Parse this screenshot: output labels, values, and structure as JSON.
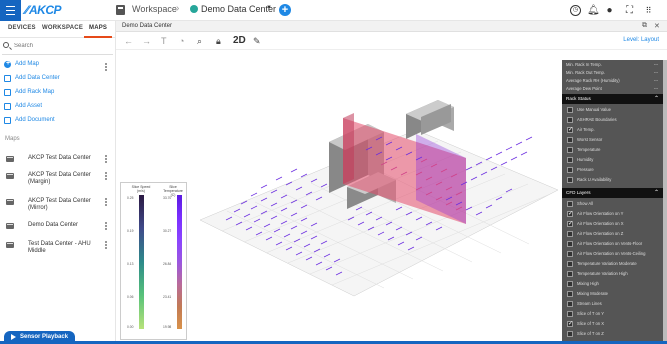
{
  "header": {
    "logo": "AKCP",
    "workspace_title": "Workspace",
    "datacenter_title": "Demo Data Center",
    "icons": [
      "menu-icon",
      "workspace-icon",
      "chevron-right-icon",
      "datacenter-dot-icon",
      "dropdown-caret-icon",
      "add-icon",
      "clock-icon",
      "notifications-icon",
      "user-icon",
      "fullscreen-icon",
      "apps-grid-icon"
    ]
  },
  "sidebar": {
    "tabs": [
      {
        "label": "DEVICES"
      },
      {
        "label": "WORKSPACE"
      },
      {
        "label": "MAPS"
      }
    ],
    "search": {
      "placeholder": "Search"
    },
    "actions": [
      {
        "label": "Add Map"
      },
      {
        "label": "Add Data Center"
      },
      {
        "label": "Add Rack Map"
      },
      {
        "label": "Add Asset"
      },
      {
        "label": "Add Document"
      }
    ],
    "maps_heading": "Maps",
    "maps": [
      {
        "name": "AKCP Test Data Center"
      },
      {
        "name": "AKCP Test Data Center (Margin)"
      },
      {
        "name": "AKCP Test Data Center (Mirror)"
      },
      {
        "name": "Demo Data Center"
      },
      {
        "name": "Test Data Center - AHU Middle"
      }
    ],
    "playback_label": "Sensor Playback"
  },
  "panel": {
    "title": "Demo Data Center",
    "toolbar": {
      "view_mode": "2D",
      "level_label": "Level: Layout"
    }
  },
  "legend": {
    "col1_title": "Slice Speed (m/s)",
    "col2_title": "Slice Temperature (C)",
    "col1_ticks": [
      "0.25",
      "0.19",
      "0.13",
      "0.06",
      "0.00"
    ],
    "col2_ticks": [
      "33.70",
      "30.27",
      "26.84",
      "23.41",
      "19.98"
    ]
  },
  "properties": {
    "metrics": [
      {
        "label": "Min. Rack In Temp.",
        "value": "---"
      },
      {
        "label": "Min. Rack Out Temp.",
        "value": "---"
      },
      {
        "label": "Average Rack RH (Humidity)",
        "value": "---"
      },
      {
        "label": "Average Dew Point",
        "value": "---"
      }
    ],
    "rack_status": {
      "title": "Rack Status",
      "items": [
        {
          "label": "Use Manual Value",
          "checked": false
        },
        {
          "label": "ASHRAE Boundaries",
          "checked": false
        },
        {
          "label": "Air Temp.",
          "checked": true
        },
        {
          "label": "Worst Sensor",
          "checked": false
        },
        {
          "label": "Temperature",
          "checked": false
        },
        {
          "label": "Humidity",
          "checked": false
        },
        {
          "label": "Pressure",
          "checked": false
        },
        {
          "label": "Rack U Availability",
          "checked": false
        }
      ]
    },
    "cfd_layers": {
      "title": "CFD Layers",
      "items": [
        {
          "label": "Show All",
          "checked": false
        },
        {
          "label": "Air Flow Orientation on Y",
          "checked": true
        },
        {
          "label": "Air Flow Orientation on X",
          "checked": true
        },
        {
          "label": "Air Flow Orientation on Z",
          "checked": false
        },
        {
          "label": "Air Flow Orientation on Vents-Floor",
          "checked": false
        },
        {
          "label": "Air Flow Orientation on Vents-Ceiling",
          "checked": false
        },
        {
          "label": "Temperature Variation Moderate",
          "checked": false
        },
        {
          "label": "Temperature Variation High",
          "checked": false
        },
        {
          "label": "Mixing High",
          "checked": false
        },
        {
          "label": "Mixing Moderate",
          "checked": false
        },
        {
          "label": "Stream Lines",
          "checked": false
        },
        {
          "label": "Slice of T on Y",
          "checked": false
        },
        {
          "label": "Slice of T on X",
          "checked": true
        },
        {
          "label": "Slice of T on Z",
          "checked": false
        }
      ]
    }
  }
}
